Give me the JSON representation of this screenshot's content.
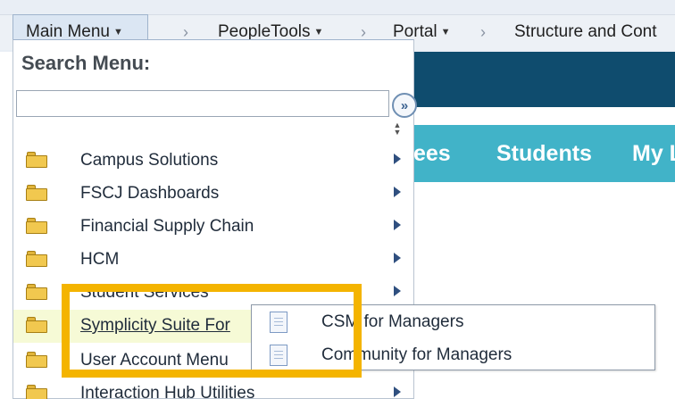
{
  "breadcrumb": {
    "main_menu": "Main Menu",
    "items": [
      "PeopleTools",
      "Portal",
      "Structure and Cont"
    ]
  },
  "portal": {
    "nav_tabs": [
      "ees",
      "Students",
      "My L"
    ]
  },
  "search_menu": {
    "title": "Search Menu:",
    "input_value": "",
    "placeholder": ""
  },
  "menu_items": [
    {
      "label": "Campus Solutions"
    },
    {
      "label": "FSCJ Dashboards"
    },
    {
      "label": "Financial Supply Chain"
    },
    {
      "label": "HCM"
    },
    {
      "label": "Student Services"
    },
    {
      "label": "Symplicity Suite For"
    },
    {
      "label": "User Account Menu"
    },
    {
      "label": "Interaction Hub Utilities"
    }
  ],
  "submenu_items": [
    {
      "label": "CSM for Managers"
    },
    {
      "label": "Community for Managers"
    }
  ],
  "colors": {
    "portal_header": "#0f4c6e",
    "portal_nav": "#41b3c8",
    "highlight_box": "#f4b400",
    "folder": "#f1c84f"
  },
  "icons": {
    "folder": "folder-icon",
    "document": "document-icon",
    "submenu_arrow": "triangle-right-icon",
    "search_go": "double-chevron-right-icon",
    "dropdown_caret": "caret-down-icon"
  }
}
